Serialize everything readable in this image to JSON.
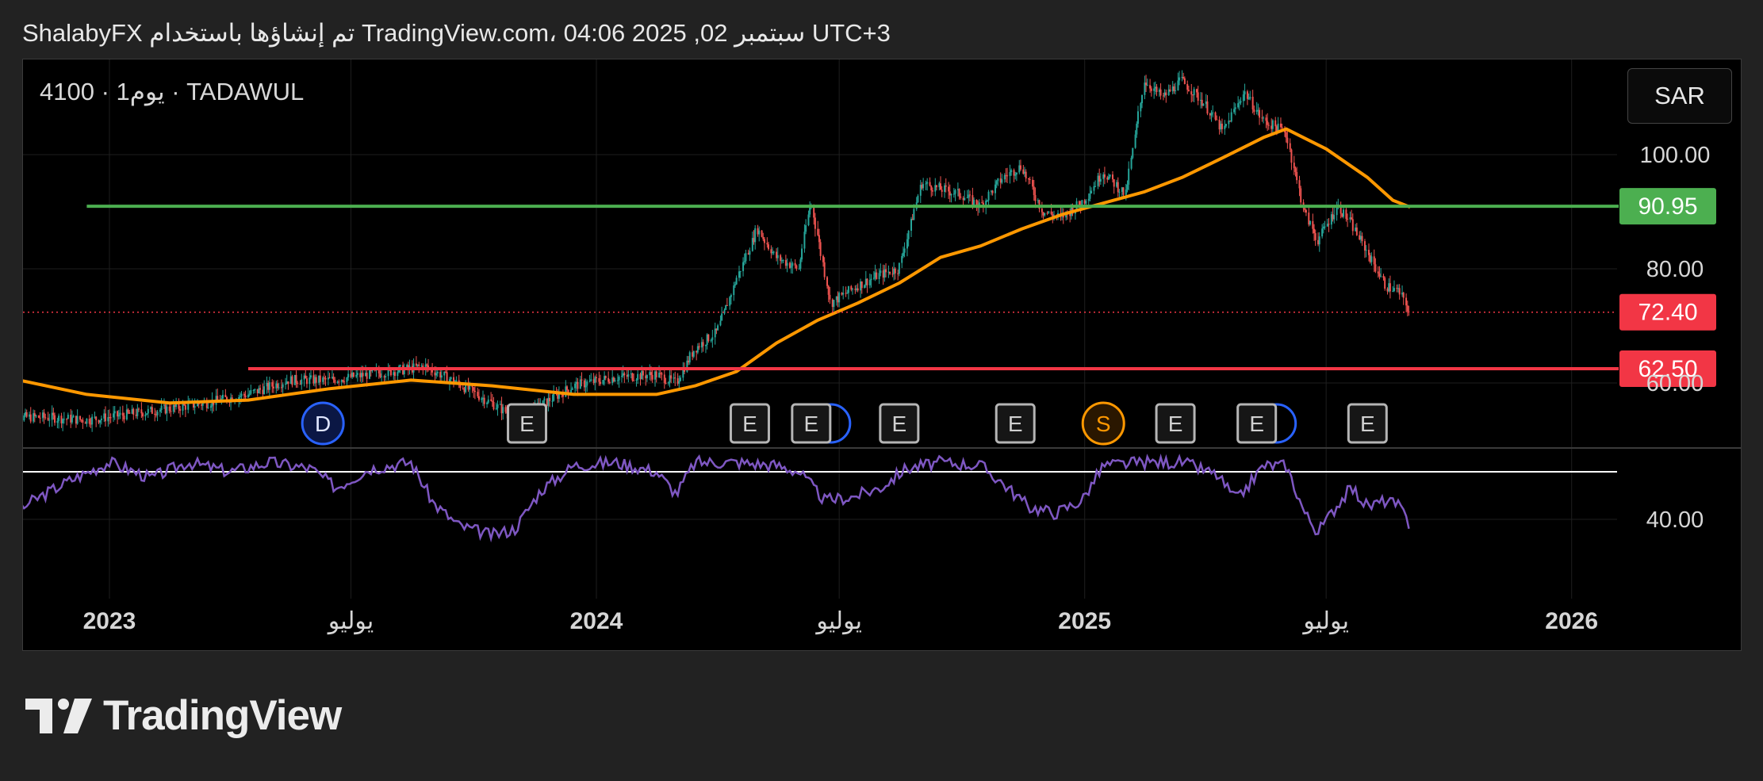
{
  "header": {
    "attribution": "ShalabyFX تم إنشاؤها باستخدام TradingView.com، 04:06 2025 ,02 سبتمبر UTC+3"
  },
  "chart_header": {
    "symbol_line": "4100 · 1يوم · TADAWUL",
    "currency": "SAR"
  },
  "footer": {
    "logo_text": "TradingView"
  },
  "colors": {
    "background": "#000000",
    "page": "#222222",
    "support_line": "#4caf50",
    "resistance_line": "#f23645",
    "moving_average": "#ff9800",
    "rsi": "#7e57c2",
    "candle_up": "#26a69a",
    "candle_down": "#ef5350",
    "price_tag_red": "#f23645",
    "price_tag_green": "#4caf50"
  },
  "chart_data": [
    {
      "type": "candlestick",
      "title": "4100 · 1يوم · TADAWUL",
      "ylabel": "SAR",
      "x_range": [
        "2022-10-15",
        "2026-04-15"
      ],
      "ylim": [
        52,
        118
      ],
      "grid": true,
      "x_ticks": [
        {
          "date": "2023-01-01",
          "label": "2023",
          "bold": true
        },
        {
          "date": "2023-07-01",
          "label": "يوليو",
          "bold": false
        },
        {
          "date": "2024-01-01",
          "label": "2024",
          "bold": true
        },
        {
          "date": "2024-07-01",
          "label": "يوليو",
          "bold": false
        },
        {
          "date": "2025-01-01",
          "label": "2025",
          "bold": true
        },
        {
          "date": "2025-07-01",
          "label": "يوليو",
          "bold": false
        },
        {
          "date": "2026-01-01",
          "label": "2026",
          "bold": true
        }
      ],
      "y_ticks": [
        {
          "value": 100,
          "label": "100.00"
        },
        {
          "value": 80,
          "label": "80.00"
        },
        {
          "value": 60,
          "label": "60.00"
        }
      ],
      "price_path": [
        [
          "2022-10-15",
          54.0
        ],
        [
          "2022-11-15",
          54.0
        ],
        [
          "2022-12-15",
          53.5
        ],
        [
          "2023-01-15",
          54.5
        ],
        [
          "2023-02-15",
          55.5
        ],
        [
          "2023-03-15",
          56.5
        ],
        [
          "2023-04-15",
          58.0
        ],
        [
          "2023-05-15",
          60.5
        ],
        [
          "2023-06-15",
          60.5
        ],
        [
          "2023-07-15",
          61.5
        ],
        [
          "2023-08-15",
          62.5
        ],
        [
          "2023-08-25",
          63.0
        ],
        [
          "2023-09-15",
          60.5
        ],
        [
          "2023-10-15",
          56.5
        ],
        [
          "2023-11-01",
          54.0
        ],
        [
          "2023-11-20",
          56.0
        ],
        [
          "2023-12-15",
          59.5
        ],
        [
          "2024-01-15",
          61.0
        ],
        [
          "2024-02-15",
          61.5
        ],
        [
          "2024-03-01",
          60.0
        ],
        [
          "2024-03-15",
          66.0
        ],
        [
          "2024-04-01",
          69.0
        ],
        [
          "2024-04-15",
          78.0
        ],
        [
          "2024-05-01",
          87.0
        ],
        [
          "2024-05-15",
          82.0
        ],
        [
          "2024-06-01",
          80.0
        ],
        [
          "2024-06-10",
          92.0
        ],
        [
          "2024-06-25",
          74.0
        ],
        [
          "2024-07-15",
          77.0
        ],
        [
          "2024-08-01",
          79.0
        ],
        [
          "2024-08-15",
          80.0
        ],
        [
          "2024-09-01",
          95.0
        ],
        [
          "2024-09-15",
          94.0
        ],
        [
          "2024-10-01",
          93.0
        ],
        [
          "2024-10-15",
          91.0
        ],
        [
          "2024-11-01",
          96.0
        ],
        [
          "2024-11-15",
          98.0
        ],
        [
          "2024-12-01",
          90.0
        ],
        [
          "2024-12-15",
          89.0
        ],
        [
          "2025-01-01",
          92.0
        ],
        [
          "2025-01-15",
          97.0
        ],
        [
          "2025-02-01",
          93.0
        ],
        [
          "2025-02-15",
          113.0
        ],
        [
          "2025-03-01",
          110.0
        ],
        [
          "2025-03-15",
          113.0
        ],
        [
          "2025-04-01",
          109.0
        ],
        [
          "2025-04-15",
          104.0
        ],
        [
          "2025-05-01",
          111.0
        ],
        [
          "2025-05-15",
          106.0
        ],
        [
          "2025-06-01",
          104.0
        ],
        [
          "2025-06-15",
          90.0
        ],
        [
          "2025-06-25",
          85.0
        ],
        [
          "2025-07-10",
          91.0
        ],
        [
          "2025-07-20",
          88.0
        ],
        [
          "2025-08-01",
          83.0
        ],
        [
          "2025-08-15",
          77.0
        ],
        [
          "2025-08-25",
          76.0
        ],
        [
          "2025-09-02",
          72.4
        ]
      ],
      "moving_average_path": [
        [
          "2022-10-15",
          61.0
        ],
        [
          "2022-12-15",
          58.0
        ],
        [
          "2023-02-15",
          56.5
        ],
        [
          "2023-04-15",
          57.0
        ],
        [
          "2023-06-15",
          59.0
        ],
        [
          "2023-08-15",
          60.5
        ],
        [
          "2023-10-15",
          59.5
        ],
        [
          "2023-12-15",
          58.0
        ],
        [
          "2024-02-15",
          58.0
        ],
        [
          "2024-03-15",
          59.5
        ],
        [
          "2024-04-15",
          62.0
        ],
        [
          "2024-05-15",
          67.0
        ],
        [
          "2024-06-15",
          71.0
        ],
        [
          "2024-07-15",
          74.0
        ],
        [
          "2024-08-15",
          77.5
        ],
        [
          "2024-09-15",
          82.0
        ],
        [
          "2024-10-15",
          84.0
        ],
        [
          "2024-11-15",
          87.0
        ],
        [
          "2024-12-15",
          89.5
        ],
        [
          "2025-01-15",
          91.5
        ],
        [
          "2025-02-15",
          93.5
        ],
        [
          "2025-03-15",
          96.0
        ],
        [
          "2025-04-15",
          99.5
        ],
        [
          "2025-05-15",
          103.0
        ],
        [
          "2025-06-01",
          104.5
        ],
        [
          "2025-07-01",
          101.0
        ],
        [
          "2025-08-01",
          96.0
        ],
        [
          "2025-08-20",
          92.0
        ],
        [
          "2025-09-02",
          90.8
        ]
      ],
      "horizontal_lines": [
        {
          "name": "support",
          "value": 90.95,
          "label": "90.95",
          "color": "#4caf50",
          "from": "2022-12-15"
        },
        {
          "name": "resistance",
          "value": 62.5,
          "label": "62.50",
          "color": "#f23645",
          "from": "2023-04-15"
        }
      ],
      "last_price": {
        "value": 72.4,
        "label": "72.40"
      },
      "events": [
        {
          "date": "2023-06-10",
          "type": "D",
          "label": "D"
        },
        {
          "date": "2023-11-10",
          "type": "E",
          "label": "E"
        },
        {
          "date": "2024-04-25",
          "type": "E",
          "label": "E"
        },
        {
          "date": "2024-06-10",
          "type": "E",
          "label": "E",
          "hidden_dividend": true
        },
        {
          "date": "2024-08-15",
          "type": "E",
          "label": "E"
        },
        {
          "date": "2024-11-10",
          "type": "E",
          "label": "E"
        },
        {
          "date": "2025-01-15",
          "type": "S",
          "label": "S"
        },
        {
          "date": "2025-03-10",
          "type": "E",
          "label": "E"
        },
        {
          "date": "2025-05-10",
          "type": "E",
          "label": "E",
          "hidden_dividend": true
        },
        {
          "date": "2025-08-01",
          "type": "E",
          "label": "E"
        }
      ]
    },
    {
      "type": "line",
      "name": "rsi",
      "ylim": [
        32,
        58
      ],
      "y_ticks": [
        {
          "value": 40,
          "label": "40.00"
        }
      ],
      "upper_band": 55,
      "series": [
        {
          "values_path": [
            [
              "2022-10-15",
              38
            ],
            [
              "2022-11-01",
              45
            ],
            [
              "2022-12-01",
              52
            ],
            [
              "2023-01-01",
              58
            ],
            [
              "2023-02-01",
              53
            ],
            [
              "2023-03-01",
              58
            ],
            [
              "2023-04-01",
              55
            ],
            [
              "2023-05-01",
              58
            ],
            [
              "2023-06-01",
              56
            ],
            [
              "2023-06-20",
              50
            ],
            [
              "2023-07-15",
              56
            ],
            [
              "2023-08-15",
              58
            ],
            [
              "2023-09-01",
              45
            ],
            [
              "2023-09-20",
              38
            ],
            [
              "2023-10-15",
              35
            ],
            [
              "2023-11-01",
              37
            ],
            [
              "2023-11-20",
              49
            ],
            [
              "2023-12-15",
              57
            ],
            [
              "2024-01-15",
              58
            ],
            [
              "2024-02-15",
              55
            ],
            [
              "2024-03-01",
              48
            ],
            [
              "2024-03-15",
              58
            ],
            [
              "2024-04-15",
              58
            ],
            [
              "2024-05-15",
              57
            ],
            [
              "2024-06-01",
              55
            ],
            [
              "2024-06-20",
              46
            ],
            [
              "2024-07-10",
              47
            ],
            [
              "2024-08-01",
              50
            ],
            [
              "2024-08-20",
              56
            ],
            [
              "2024-09-15",
              58
            ],
            [
              "2024-10-15",
              57
            ],
            [
              "2024-10-30",
              52
            ],
            [
              "2024-11-20",
              44
            ],
            [
              "2024-12-10",
              42
            ],
            [
              "2024-12-30",
              46
            ],
            [
              "2025-01-15",
              57
            ],
            [
              "2025-02-15",
              58
            ],
            [
              "2025-03-15",
              58
            ],
            [
              "2025-04-10",
              54
            ],
            [
              "2025-04-25",
              46
            ],
            [
              "2025-05-15",
              57
            ],
            [
              "2025-06-01",
              57
            ],
            [
              "2025-06-15",
              42
            ],
            [
              "2025-06-25",
              36
            ],
            [
              "2025-07-10",
              45
            ],
            [
              "2025-07-20",
              50
            ],
            [
              "2025-08-01",
              44
            ],
            [
              "2025-08-15",
              46
            ],
            [
              "2025-08-25",
              44
            ],
            [
              "2025-09-02",
              38
            ]
          ]
        }
      ]
    }
  ]
}
